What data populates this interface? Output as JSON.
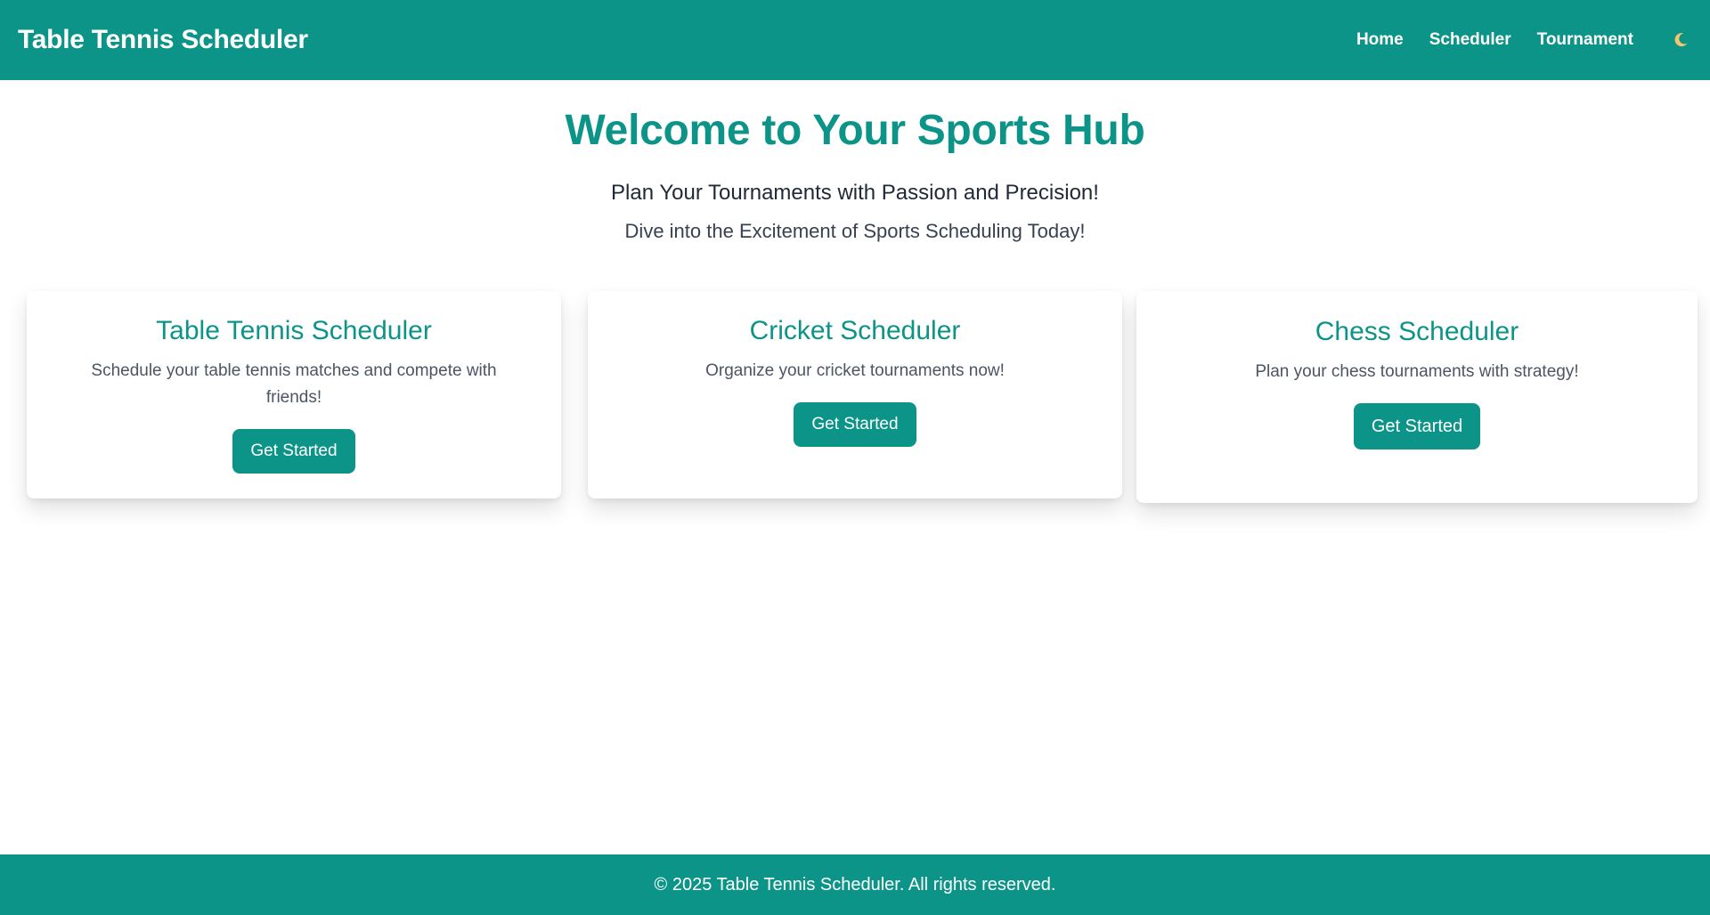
{
  "navbar": {
    "brand": "Table Tennis Scheduler",
    "links": [
      "Home",
      "Scheduler",
      "Tournament"
    ],
    "theme_toggle_icon": "moon-icon"
  },
  "hero": {
    "title": "Welcome to Your Sports Hub",
    "tagline": "Plan Your Tournaments with Passion and Precision!",
    "subtitle": "Dive into the Excitement of Sports Scheduling Today!"
  },
  "cards": [
    {
      "title": "Table Tennis Scheduler",
      "description": "Schedule your table tennis matches and compete with friends!",
      "button": "Get Started"
    },
    {
      "title": "Cricket Scheduler",
      "description": "Organize your cricket tournaments now!",
      "button": "Get Started"
    },
    {
      "title": "Chess Scheduler",
      "description": "Plan your chess tournaments with strategy!",
      "button": "Get Started"
    }
  ],
  "footer": {
    "text": "© 2025 Table Tennis Scheduler. All rights reserved."
  },
  "colors": {
    "primary": "#0d9488",
    "moon": "#f5c56b"
  }
}
